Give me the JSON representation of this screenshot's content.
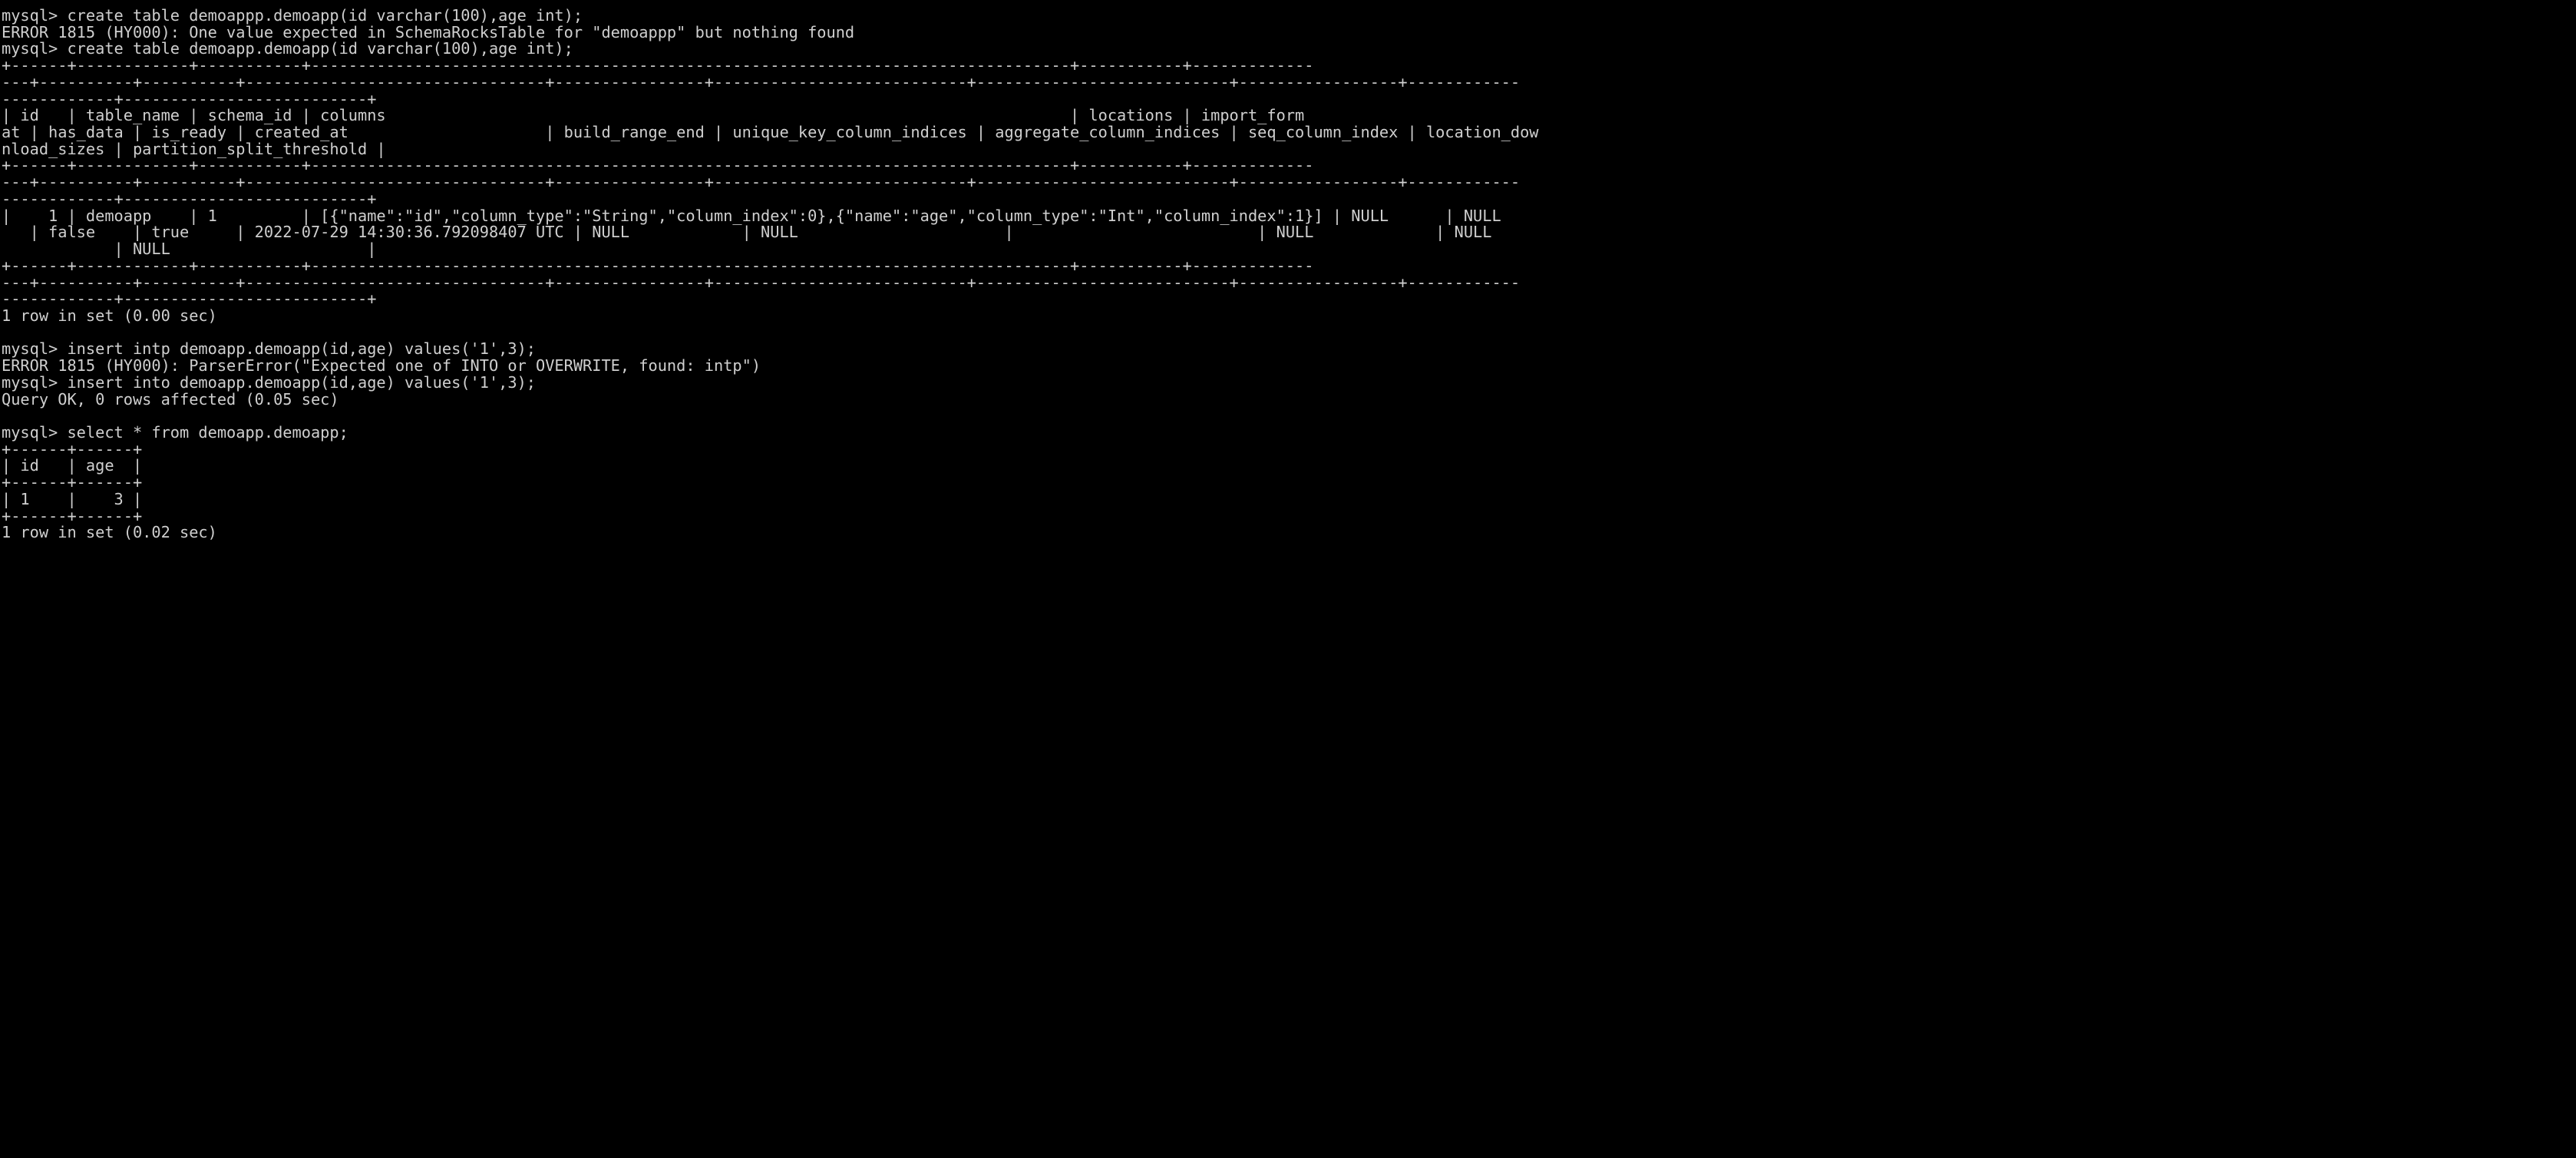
{
  "terminal": {
    "title": "mysql-cli-session",
    "background_color": "#000000",
    "foreground_color": "#cfcfcf",
    "prompt": "mysql> ",
    "font_size_px": 20,
    "columns": 163,
    "lines": [
      "mysql> create table demoappp.demoapp(id varchar(100),age int);",
      "ERROR 1815 (HY000): One value expected in SchemaRocksTable for \"demoappp\" but nothing found",
      "mysql> create table demoapp.demoapp(id varchar(100),age int);",
      "+------+------------+-----------+---------------------------------------------------------------------------------+-----------+-------------",
      "---+----------+----------+--------------------------------+----------------+---------------------------+---------------------------+-----------------+------------",
      "------------+--------------------------+",
      "| id   | table_name | schema_id | columns                                                                         | locations | import_form",
      "at | has_data | is_ready | created_at                     | build_range_end | unique_key_column_indices | aggregate_column_indices | seq_column_index | location_dow",
      "nload_sizes | partition_split_threshold |",
      "+------+------------+-----------+---------------------------------------------------------------------------------+-----------+-------------",
      "---+----------+----------+--------------------------------+----------------+---------------------------+---------------------------+-----------------+------------",
      "------------+--------------------------+",
      "|    1 | demoapp    | 1         | [{\"name\":\"id\",\"column_type\":\"String\",\"column_index\":0},{\"name\":\"age\",\"column_type\":\"Int\",\"column_index\":1}] | NULL      | NULL",
      "   | false    | true     | 2022-07-29 14:30:36.792098407 UTC | NULL            | NULL                      |                          | NULL             | NULL",
      "            | NULL                     |",
      "+------+------------+-----------+---------------------------------------------------------------------------------+-----------+-------------",
      "---+----------+----------+--------------------------------+----------------+---------------------------+---------------------------+-----------------+------------",
      "------------+--------------------------+",
      "1 row in set (0.00 sec)",
      "",
      "mysql> insert intp demoapp.demoapp(id,age) values('1',3);",
      "ERROR 1815 (HY000): ParserError(\"Expected one of INTO or OVERWRITE, found: intp\")",
      "mysql> insert into demoapp.demoapp(id,age) values('1',3);",
      "Query OK, 0 rows affected (0.05 sec)",
      "",
      "mysql> select * from demoapp.demoapp;",
      "+------+------+",
      "| id   | age  |",
      "+------+------+",
      "| 1    |    3 |",
      "+------+------+",
      "1 row in set (0.02 sec)"
    ],
    "commands": [
      {
        "prompt": "mysql> ",
        "command": "create table demoappp.demoapp(id varchar(100),age int);",
        "result": "ERROR 1815 (HY000): One value expected in SchemaRocksTable for \"demoappp\" but nothing found",
        "status": "error"
      },
      {
        "prompt": "mysql> ",
        "command": "create table demoapp.demoapp(id varchar(100),age int);",
        "result": "1 row in set (0.00 sec)",
        "status": "ok"
      },
      {
        "prompt": "mysql> ",
        "command": "insert intp demoapp.demoapp(id,age) values('1',3);",
        "result": "ERROR 1815 (HY000): ParserError(\"Expected one of INTO or OVERWRITE, found: intp\")",
        "status": "error"
      },
      {
        "prompt": "mysql> ",
        "command": "insert into demoapp.demoapp(id,age) values('1',3);",
        "result": "Query OK, 0 rows affected (0.05 sec)",
        "status": "ok"
      },
      {
        "prompt": "mysql> ",
        "command": "select * from demoapp.demoapp;",
        "result": "1 row in set (0.02 sec)",
        "status": "ok"
      }
    ],
    "result_table_catalog": {
      "columns": [
        "id",
        "table_name",
        "schema_id",
        "columns",
        "locations",
        "import_format",
        "has_data",
        "is_ready",
        "created_at",
        "build_range_end",
        "unique_key_column_indices",
        "aggregate_column_indices",
        "seq_column_index",
        "location_download_sizes",
        "partition_split_threshold"
      ],
      "rows": [
        {
          "id": "1",
          "table_name": "demoapp",
          "schema_id": "1",
          "columns": "[{\"name\":\"id\",\"column_type\":\"String\",\"column_index\":0},{\"name\":\"age\",\"column_type\":\"Int\",\"column_index\":1}]",
          "locations": "NULL",
          "import_format": "NULL",
          "has_data": "false",
          "is_ready": "true",
          "created_at": "2022-07-29 14:30:36.792098407 UTC",
          "build_range_end": "NULL",
          "unique_key_column_indices": "NULL",
          "aggregate_column_indices": "",
          "seq_column_index": "NULL",
          "location_download_sizes": "NULL",
          "partition_split_threshold": "NULL"
        }
      ],
      "footer": "1 row in set (0.00 sec)"
    },
    "result_table_select": {
      "columns": [
        "id",
        "age"
      ],
      "rows": [
        {
          "id": "1",
          "age": "3"
        }
      ],
      "footer": "1 row in set (0.02 sec)"
    }
  }
}
